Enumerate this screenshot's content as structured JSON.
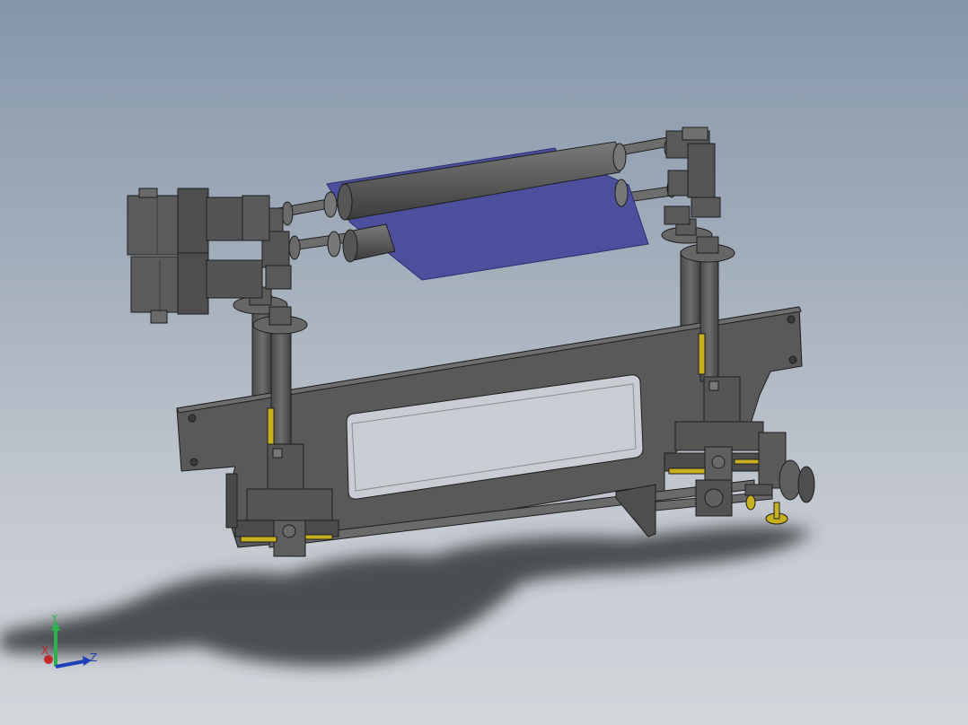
{
  "viewport": {
    "background_top": "#8596aa",
    "background_bottom": "#d3d6db"
  },
  "model": {
    "part_color": "#5a5a5a",
    "edge_color": "#1e1e1e",
    "sheet_color": "#4b4f9c",
    "accent_color": "#c8b020",
    "shadow_color": "#3a3c40"
  },
  "triad": {
    "y_label": "Y",
    "x_label": "X",
    "z_label": "Z",
    "y_color": "#2bb24c",
    "x_color": "#c0282a",
    "z_color": "#1f3fb8"
  }
}
